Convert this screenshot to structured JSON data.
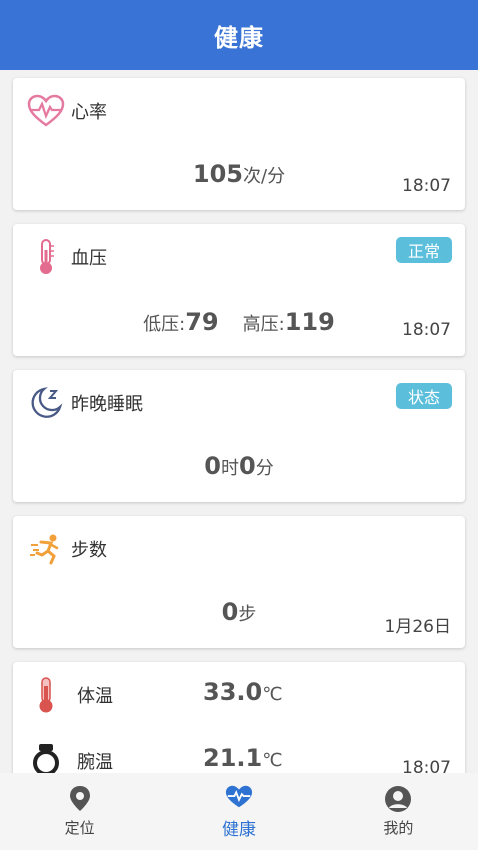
{
  "header": {
    "title": "健康"
  },
  "heart": {
    "title": "心率",
    "value": "105",
    "unit": "次/分",
    "time": "18:07"
  },
  "bp": {
    "title": "血压",
    "badge": "正常",
    "low_label": "低压:",
    "low_value": "79",
    "high_label": "高压:",
    "high_value": "119",
    "time": "18:07"
  },
  "sleep": {
    "title": "昨晚睡眠",
    "badge": "状态",
    "hours": "0",
    "hours_unit": "时",
    "minutes": "0",
    "minutes_unit": "分"
  },
  "steps": {
    "title": "步数",
    "value": "0",
    "unit": "步",
    "date": "1月26日"
  },
  "temperature": {
    "body_label": "体温",
    "body_value": "33.0",
    "body_unit": "℃",
    "wrist_label": "腕温",
    "wrist_value": "21.1",
    "wrist_unit": "℃",
    "time": "18:07"
  },
  "tabbar": {
    "tabs": [
      {
        "label": "定位",
        "icon": "location-pin-icon"
      },
      {
        "label": "健康",
        "icon": "heart-pulse-icon"
      },
      {
        "label": "我的",
        "icon": "user-profile-icon"
      }
    ],
    "active_color": "#2e72d2"
  },
  "colors": {
    "header_bg": "#3a73d6",
    "badge_bg": "#5bbfdc"
  }
}
